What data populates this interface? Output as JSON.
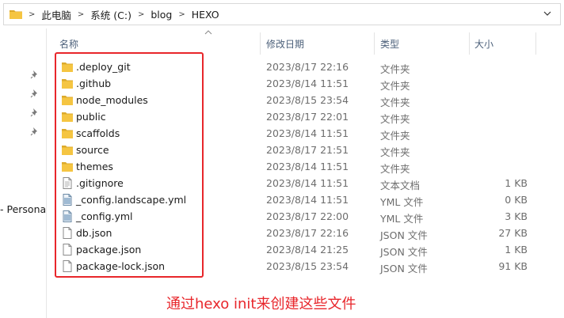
{
  "breadcrumb": [
    "此电脑",
    "系统 (C:)",
    "blog",
    "HEXO"
  ],
  "columns": {
    "name": "名称",
    "date": "修改日期",
    "type": "类型",
    "size": "大小"
  },
  "left_pane": {
    "item_text": "- Persona"
  },
  "files": [
    {
      "name": ".deploy_git",
      "date": "2023/8/17 22:16",
      "type": "文件夹",
      "size": "",
      "icon": "folder-icon"
    },
    {
      "name": ".github",
      "date": "2023/8/14 11:51",
      "type": "文件夹",
      "size": "",
      "icon": "folder-icon"
    },
    {
      "name": "node_modules",
      "date": "2023/8/15 23:54",
      "type": "文件夹",
      "size": "",
      "icon": "folder-icon"
    },
    {
      "name": "public",
      "date": "2023/8/17 22:01",
      "type": "文件夹",
      "size": "",
      "icon": "folder-icon"
    },
    {
      "name": "scaffolds",
      "date": "2023/8/14 11:51",
      "type": "文件夹",
      "size": "",
      "icon": "folder-icon"
    },
    {
      "name": "source",
      "date": "2023/8/17 21:51",
      "type": "文件夹",
      "size": "",
      "icon": "folder-icon"
    },
    {
      "name": "themes",
      "date": "2023/8/14 11:51",
      "type": "文件夹",
      "size": "",
      "icon": "folder-icon"
    },
    {
      "name": ".gitignore",
      "date": "2023/8/14 11:51",
      "type": "文本文档",
      "size": "1 KB",
      "icon": "text-file-icon"
    },
    {
      "name": "_config.landscape.yml",
      "date": "2023/8/14 11:51",
      "type": "YML 文件",
      "size": "0 KB",
      "icon": "yml-file-icon"
    },
    {
      "name": "_config.yml",
      "date": "2023/8/17 22:00",
      "type": "YML 文件",
      "size": "3 KB",
      "icon": "yml-file-icon"
    },
    {
      "name": "db.json",
      "date": "2023/8/17 22:16",
      "type": "JSON 文件",
      "size": "27 KB",
      "icon": "file-icon"
    },
    {
      "name": "package.json",
      "date": "2023/8/14 21:25",
      "type": "JSON 文件",
      "size": "1 KB",
      "icon": "file-icon"
    },
    {
      "name": "package-lock.json",
      "date": "2023/8/15 23:54",
      "type": "JSON 文件",
      "size": "91 KB",
      "icon": "file-icon"
    }
  ],
  "annotation": {
    "caption": "通过hexo init来创建这些文件",
    "color": "#e8262b"
  },
  "colors": {
    "folder": "#f5c542",
    "folder_dark": "#dcaa2c",
    "header_text": "#4c607a",
    "meta_text": "#6d6d6d"
  }
}
